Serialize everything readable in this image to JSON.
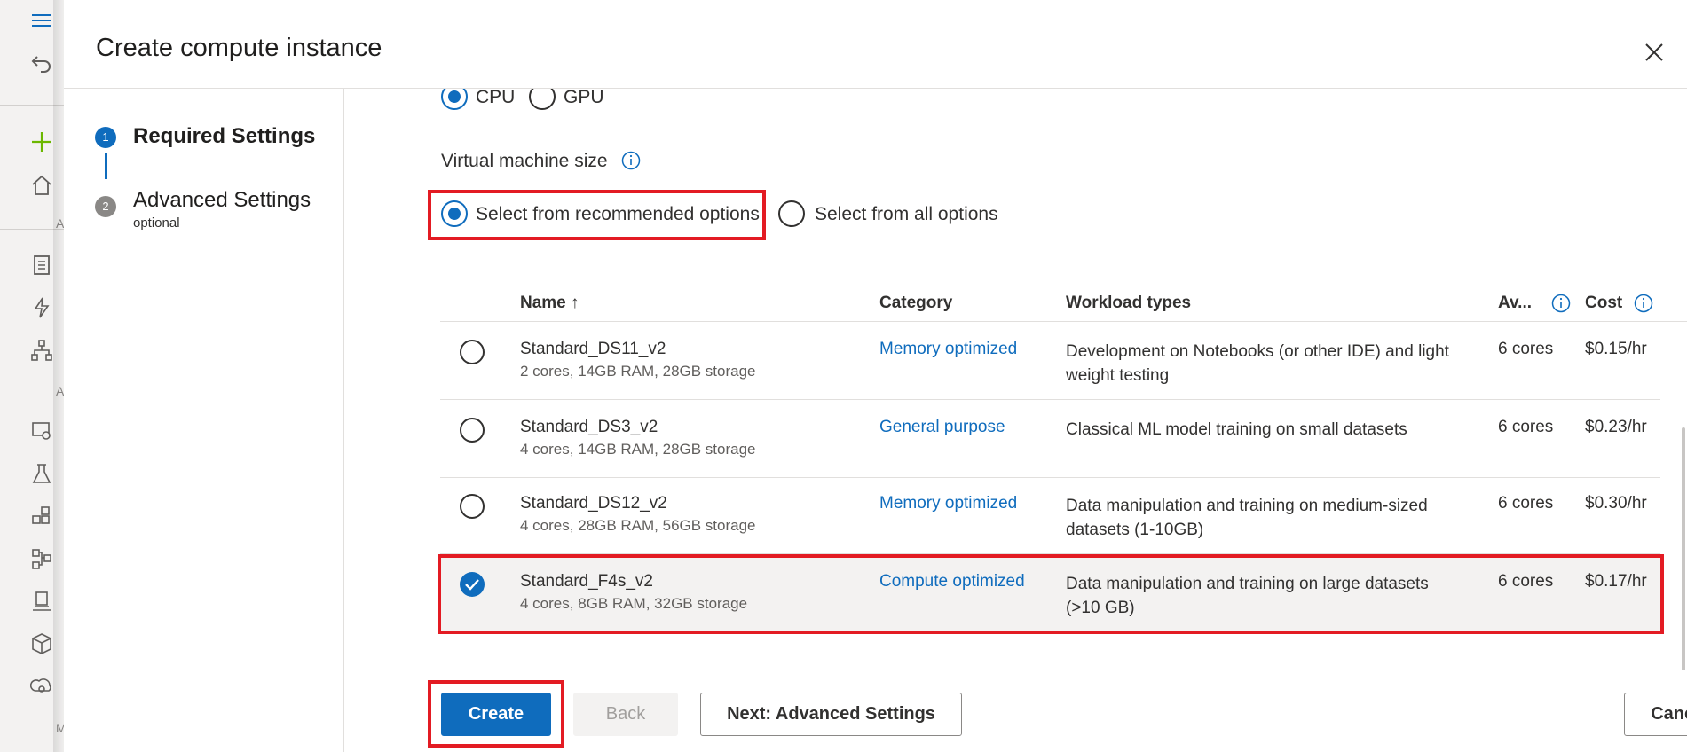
{
  "panel": {
    "title": "Create compute instance"
  },
  "steps": [
    {
      "number": "1",
      "label": "Required Settings",
      "sub": ""
    },
    {
      "number": "2",
      "label": "Advanced Settings",
      "sub": "optional"
    }
  ],
  "processor": {
    "options": [
      "CPU",
      "GPU"
    ],
    "selected": "CPU"
  },
  "vm_size": {
    "label": "Virtual machine size",
    "options": [
      "Select from recommended options",
      "Select from all options"
    ],
    "selected": "Select from recommended options"
  },
  "table": {
    "headers": {
      "name": "Name",
      "sort_indicator": "↑",
      "category": "Category",
      "workload": "Workload types",
      "available": "Av...",
      "cost": "Cost"
    },
    "rows": [
      {
        "name": "Standard_DS11_v2",
        "spec": "2 cores, 14GB RAM, 28GB storage",
        "category": "Memory optimized",
        "workload": "Development on Notebooks (or other IDE) and light weight testing",
        "available": "6 cores",
        "cost": "$0.15/hr",
        "selected": false
      },
      {
        "name": "Standard_DS3_v2",
        "spec": "4 cores, 14GB RAM, 28GB storage",
        "category": "General purpose",
        "workload": "Classical ML model training on small datasets",
        "available": "6 cores",
        "cost": "$0.23/hr",
        "selected": false
      },
      {
        "name": "Standard_DS12_v2",
        "spec": "4 cores, 28GB RAM, 56GB storage",
        "category": "Memory optimized",
        "workload": "Data manipulation and training on medium-sized datasets (1-10GB)",
        "available": "6 cores",
        "cost": "$0.30/hr",
        "selected": false
      },
      {
        "name": "Standard_F4s_v2",
        "spec": "4 cores, 8GB RAM, 32GB storage",
        "category": "Compute optimized",
        "workload": "Data manipulation and training on large datasets (>10 GB)",
        "available": "6 cores",
        "cost": "$0.17/hr",
        "selected": true
      }
    ]
  },
  "footer": {
    "create": "Create",
    "back": "Back",
    "next": "Next: Advanced Settings",
    "cancel": "Cancel"
  },
  "rail": {
    "letters": [
      "A",
      "A",
      "M"
    ]
  },
  "colors": {
    "accent": "#0f6cbd",
    "highlight": "#e31b23",
    "selected_row": "#f3f2f1"
  }
}
